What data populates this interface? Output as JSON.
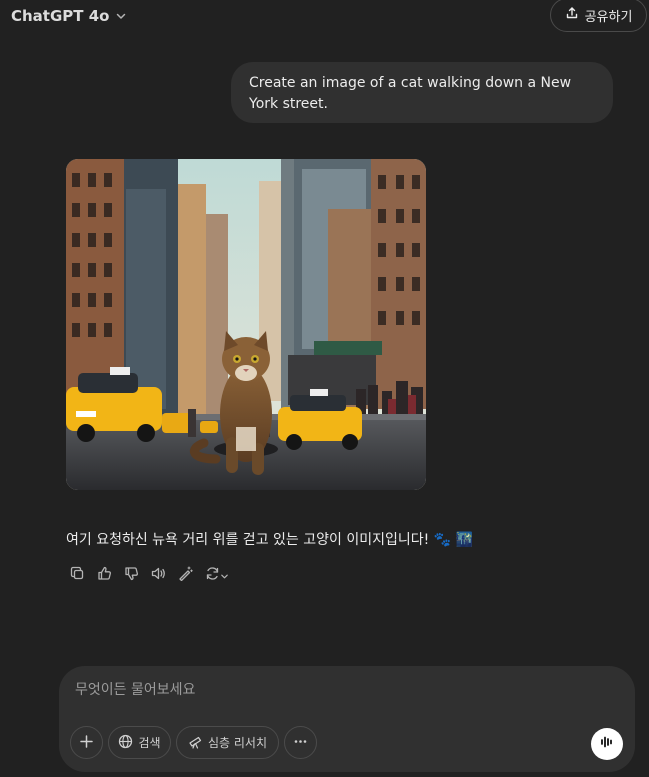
{
  "header": {
    "model_name": "ChatGPT 4o",
    "share_label": "공유하기"
  },
  "conversation": {
    "user_message": "Create an image of a cat walking down a New York street.",
    "assistant_reply": "여기 요청하신 뉴욕 거리 위를 걷고 있는 고양이 이미지입니다! 🐾 🌃"
  },
  "composer": {
    "placeholder": "무엇이든 물어보세요",
    "search_label": "검색",
    "research_label": "심층 리서치"
  },
  "icons": {
    "model_chevron": "chevron-down-icon",
    "share": "share-icon",
    "copy": "copy-icon",
    "thumbs_up": "thumbs-up-icon",
    "thumbs_down": "thumbs-down-icon",
    "read_aloud": "speaker-icon",
    "edit_image": "magic-wand-icon",
    "regenerate": "refresh-icon",
    "plus": "plus-icon",
    "globe": "globe-icon",
    "telescope": "telescope-icon",
    "more": "ellipsis-icon",
    "voice": "voice-waveform-icon"
  },
  "colors": {
    "background": "#212121",
    "bubble": "#303030",
    "text": "#ececec",
    "taxi_yellow": "#f2b516"
  }
}
